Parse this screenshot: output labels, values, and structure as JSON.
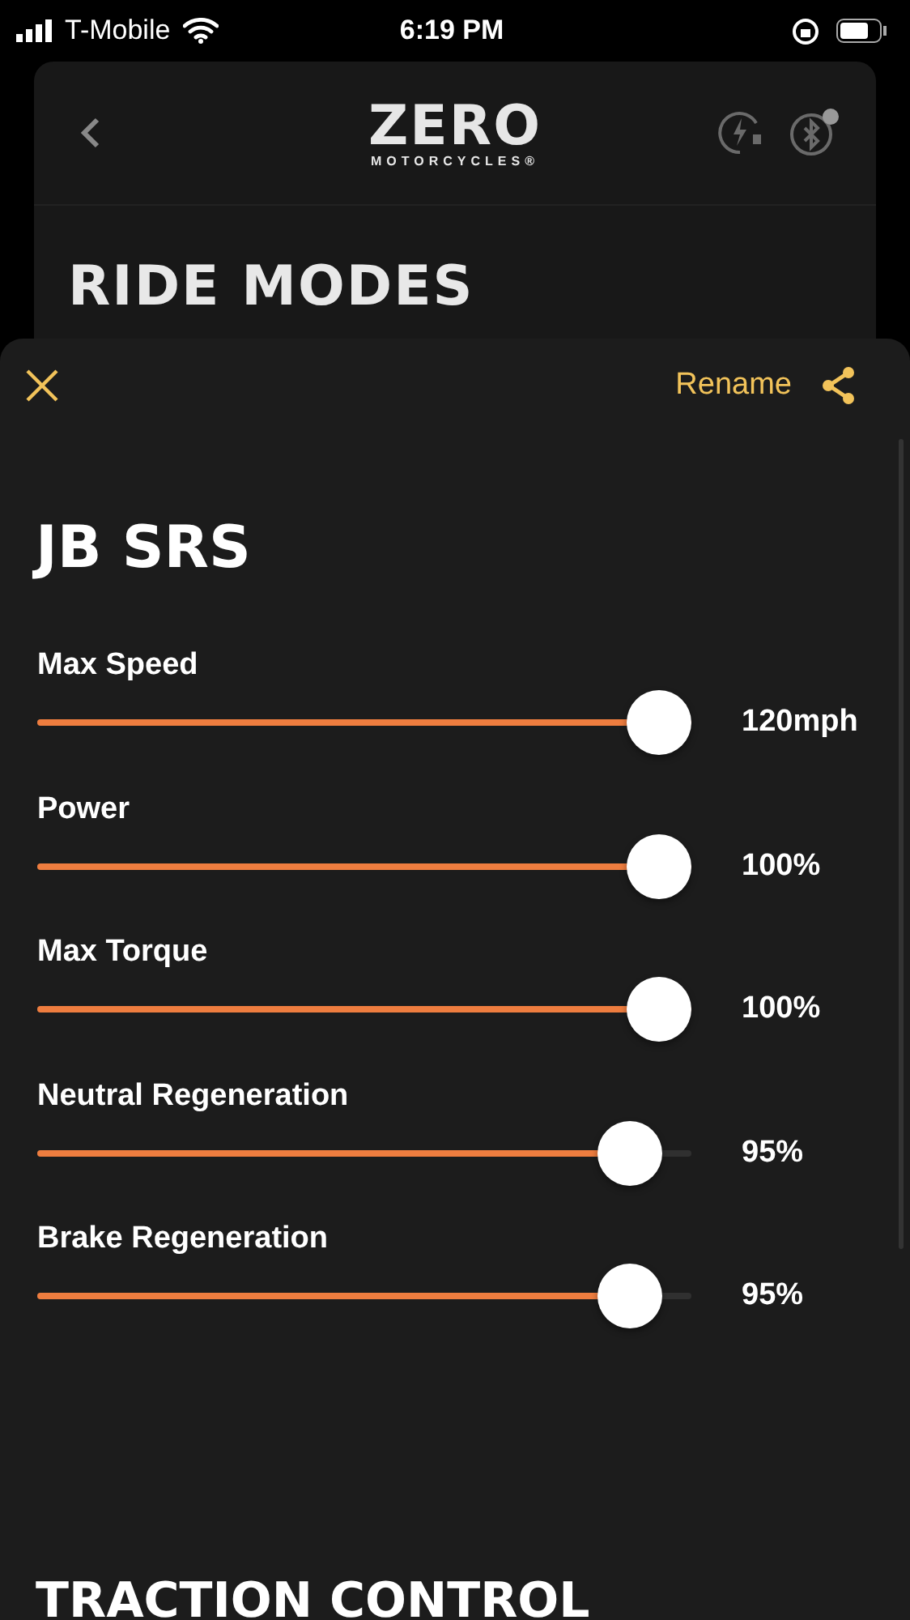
{
  "status_bar": {
    "carrier": "T-Mobile",
    "time": "6:19 PM"
  },
  "header": {
    "logo": {
      "word": "ZERO",
      "subtitle": "MOTORCYCLES®"
    },
    "bluetooth_alert": true
  },
  "page_title": "RIDE MODES",
  "sheet": {
    "rename": "Rename",
    "title": "JB SRS",
    "sliders": [
      {
        "label": "Max Speed",
        "level": 1,
        "reading": "120mph"
      },
      {
        "label": "Power",
        "level": 1,
        "reading": "100%"
      },
      {
        "label": "Max Torque",
        "level": 1,
        "reading": "100%"
      },
      {
        "label": "Neutral Regeneration",
        "level": 0.95,
        "reading": "95%"
      },
      {
        "label": "Brake Regeneration",
        "level": 0.95,
        "reading": "95%"
      }
    ],
    "next_section": "TRACTION CONTROL"
  }
}
